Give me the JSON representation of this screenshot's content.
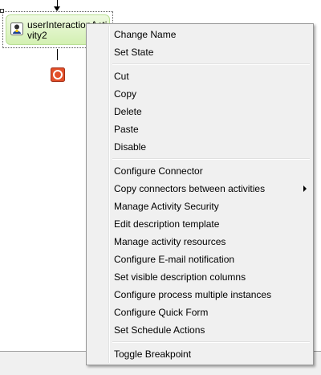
{
  "canvas": {
    "activity": {
      "label": "userInteractionActivity2",
      "icon": "user-task-icon"
    },
    "end_event": {
      "icon": "stop-icon",
      "color": "#e2502a"
    }
  },
  "context_menu": {
    "groups": [
      [
        "Change Name",
        "Set State"
      ],
      [
        "Cut",
        "Copy",
        "Delete",
        "Paste",
        "Disable"
      ],
      [
        "Configure Connector",
        "Copy connectors between activities",
        "Manage Activity Security",
        "Edit description template",
        "Manage activity resources",
        "Configure E-mail notification",
        "Set visible description columns",
        "Configure process multiple instances",
        "Configure Quick Form",
        "Set Schedule Actions"
      ],
      [
        "Toggle Breakpoint"
      ]
    ],
    "submenu_item": "Copy connectors between activities"
  }
}
